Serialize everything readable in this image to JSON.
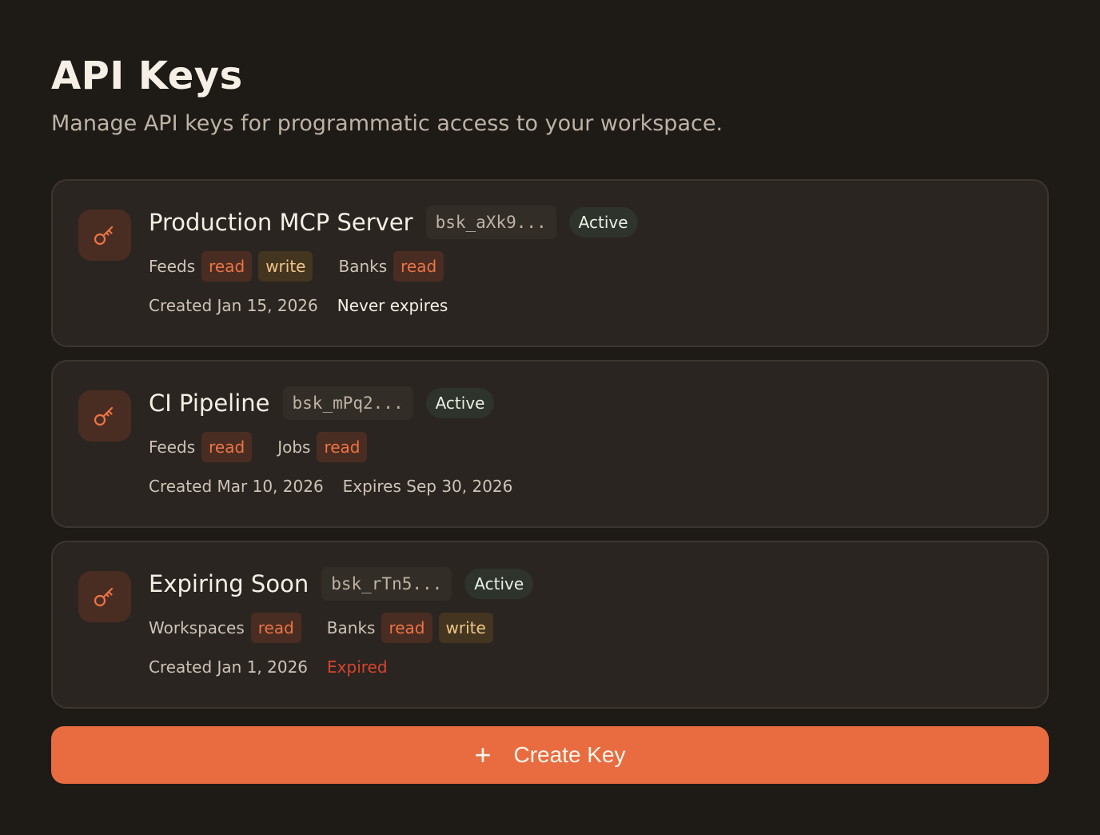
{
  "header": {
    "title": "API Keys",
    "subtitle": "Manage API keys for programmatic access to your workspace."
  },
  "keys": [
    {
      "name": "Production MCP Server",
      "prefix": "bsk_aXk9...",
      "status": "Active",
      "permissions": [
        {
          "resource": "Feeds",
          "scopes": [
            "read",
            "write"
          ]
        },
        {
          "resource": "Banks",
          "scopes": [
            "read"
          ]
        }
      ],
      "created": "Created Jan 15, 2026",
      "expiry": "Never expires",
      "expiry_state": "never"
    },
    {
      "name": "CI Pipeline",
      "prefix": "bsk_mPq2...",
      "status": "Active",
      "permissions": [
        {
          "resource": "Feeds",
          "scopes": [
            "read"
          ]
        },
        {
          "resource": "Jobs",
          "scopes": [
            "read"
          ]
        }
      ],
      "created": "Created Mar 10, 2026",
      "expiry": "Expires Sep 30, 2026",
      "expiry_state": "date"
    },
    {
      "name": "Expiring Soon",
      "prefix": "bsk_rTn5...",
      "status": "Active",
      "permissions": [
        {
          "resource": "Workspaces",
          "scopes": [
            "read"
          ]
        },
        {
          "resource": "Banks",
          "scopes": [
            "read",
            "write"
          ]
        }
      ],
      "created": "Created Jan 1, 2026",
      "expiry": "Expired",
      "expiry_state": "expired"
    }
  ],
  "actions": {
    "create_label": "Create Key",
    "create_icon": "+"
  },
  "colors": {
    "background": "#1e1a16",
    "card": "#2a2520",
    "accent": "#e86c40",
    "read_tag": "#ec7446",
    "write_tag": "#f0c58a",
    "expired": "#d9432f"
  }
}
